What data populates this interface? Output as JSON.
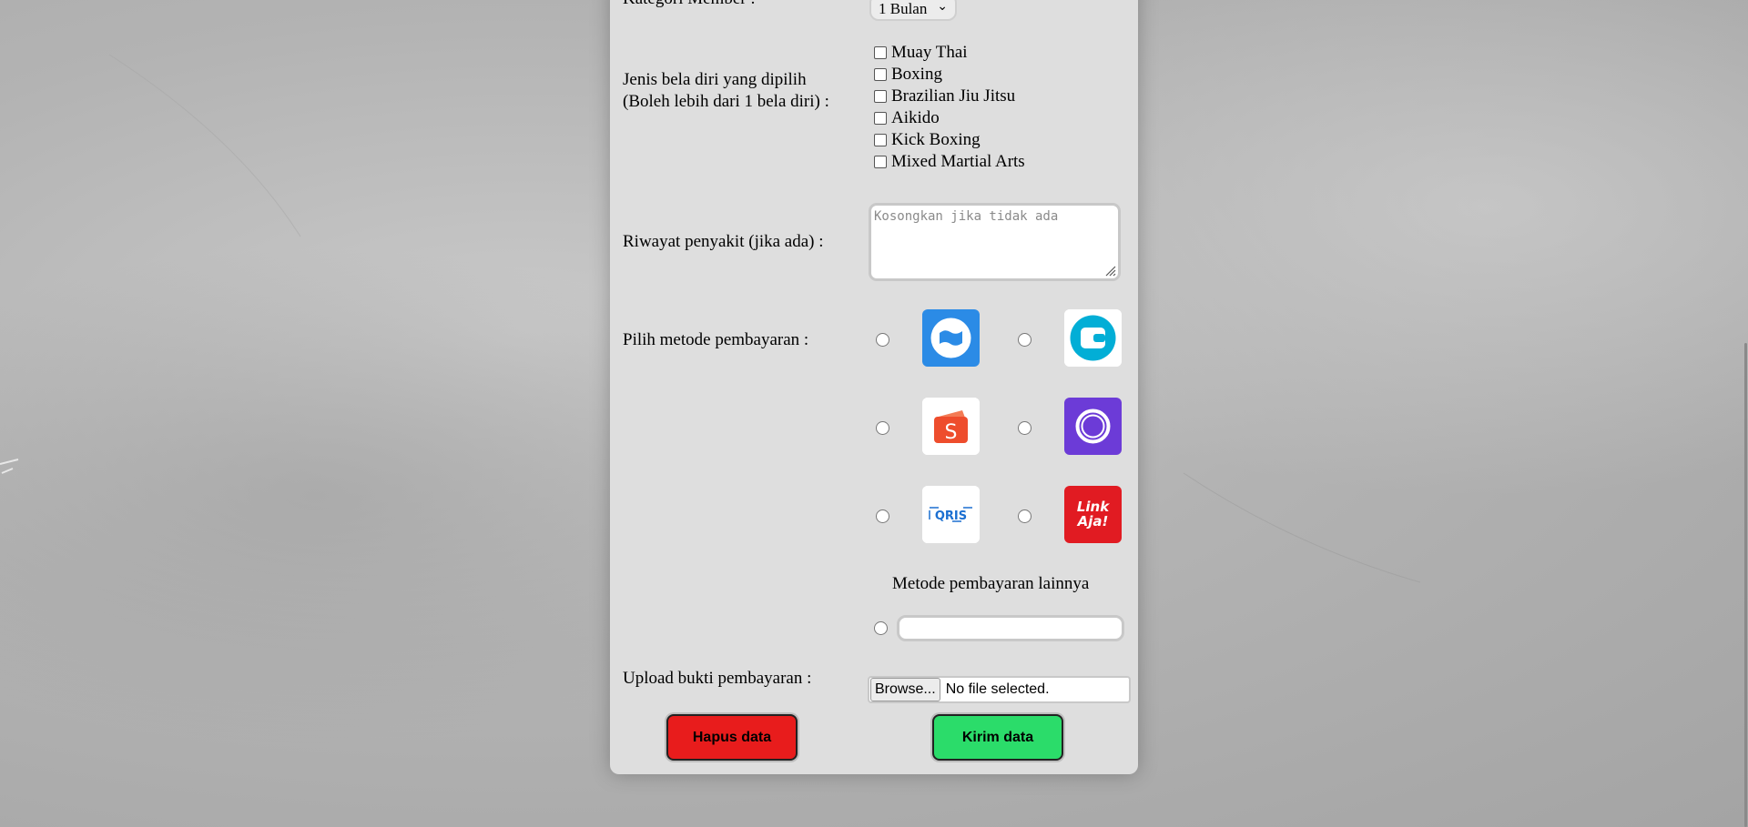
{
  "form": {
    "member_category_label": "Kategori Member :",
    "member_category_value": "1 Bulan",
    "martial_arts_label_line1": "Jenis bela diri yang dipilih",
    "martial_arts_label_line2": "(Boleh lebih dari 1 bela diri) :",
    "martial_arts_options": [
      "Muay Thai",
      "Boxing",
      "Brazilian Jiu Jitsu",
      "Aikido",
      "Kick Boxing",
      "Mixed Martial Arts"
    ],
    "medical_history_label": "Riwayat penyakit (jika ada) :",
    "medical_history_placeholder": "Kosongkan jika tidak ada",
    "payment_method_label": "Pilih metode pembayaran :",
    "payment_methods": [
      {
        "icon": "dana-icon",
        "color": "#2b8be6"
      },
      {
        "icon": "wallet-icon",
        "color": "#02aed6"
      },
      {
        "icon": "shopeepay-icon",
        "color": "#ee4d2d"
      },
      {
        "icon": "ovo-icon",
        "color": "#6c3bd7"
      },
      {
        "icon": "qris-icon",
        "color": "#1b6fd1"
      },
      {
        "icon": "linkaja-icon",
        "color": "#e11b22"
      }
    ],
    "other_payment_label": "Metode pembayaran lainnya",
    "upload_label": "Upload bukti pembayaran :",
    "browse_label": "Browse...",
    "file_status": "No file selected.",
    "delete_button": "Hapus data",
    "submit_button": "Kirim data"
  },
  "colors": {
    "delete": "#e81c1c",
    "submit": "#2bdc6a",
    "card": "#dedede"
  }
}
